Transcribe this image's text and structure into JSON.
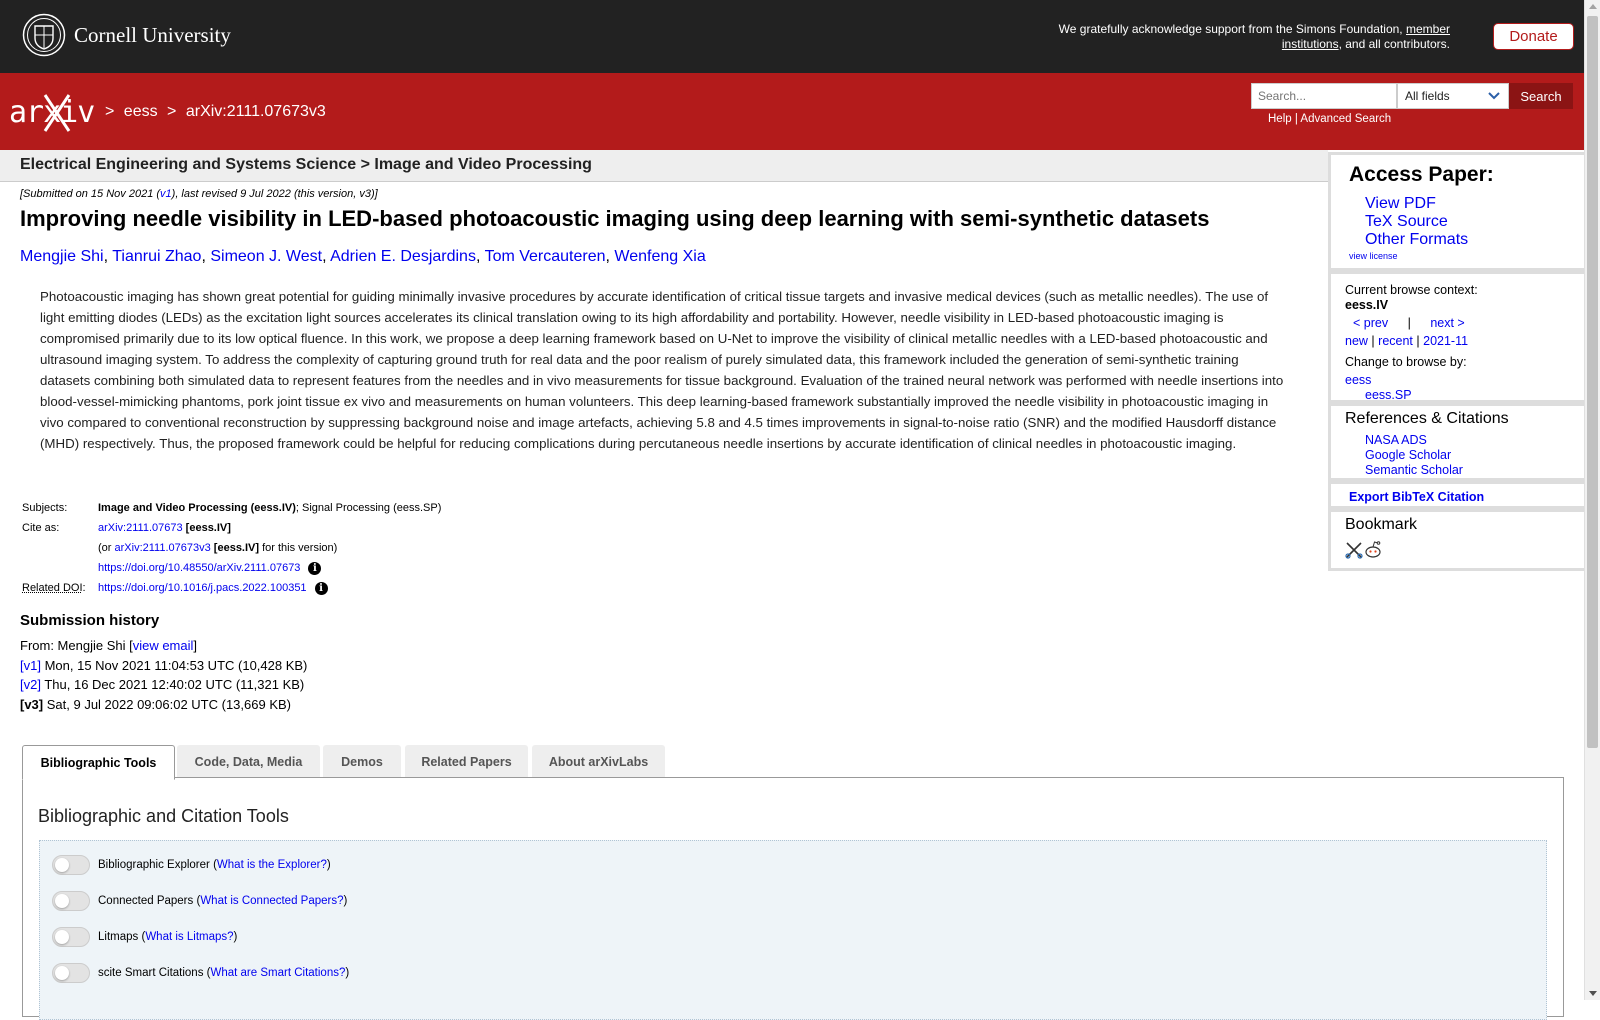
{
  "header": {
    "university": "Cornell University",
    "support_text": "We gratefully acknowledge support from the Simons Foundation,",
    "support_link": "member institutions",
    "support_tail": ", and all contributors.",
    "donate": "Donate"
  },
  "arxiv": {
    "crumb_sep": ">",
    "crumb_category": "eess",
    "crumb_id": "arXiv:2111.07673v3",
    "search_placeholder": "Search...",
    "search_field": "All fields",
    "search_button": "Search",
    "help": "Help",
    "link_sep": "|",
    "advanced": "Advanced Search"
  },
  "subheader": "Electrical Engineering and Systems Science > Image and Video Processing",
  "paper": {
    "submitted_prefix": "[Submitted on 15 Nov 2021 (",
    "submitted_v1": "v1",
    "submitted_suffix": "), last revised 9 Jul 2022 (this version, v3)]",
    "title": "Improving needle visibility in LED-based photoacoustic imaging using deep learning with semi-synthetic datasets",
    "authors": [
      "Mengjie Shi",
      "Tianrui Zhao",
      "Simeon J. West",
      "Adrien E. Desjardins",
      "Tom Vercauteren",
      "Wenfeng Xia"
    ],
    "abstract": "Photoacoustic imaging has shown great potential for guiding minimally invasive procedures by accurate identification of critical tissue targets and invasive medical devices (such as metallic needles). The use of light emitting diodes (LEDs) as the excitation light sources accelerates its clinical translation owing to its high affordability and portability. However, needle visibility in LED-based photoacoustic imaging is compromised primarily due to its low optical fluence. In this work, we propose a deep learning framework based on U-Net to improve the visibility of clinical metallic needles with a LED-based photoacoustic and ultrasound imaging system. To address the complexity of capturing ground truth for real data and the poor realism of purely simulated data, this framework included the generation of semi-synthetic training datasets combining both simulated data to represent features from the needles and in vivo measurements for tissue background. Evaluation of the trained neural network was performed with needle insertions into blood-vessel-mimicking phantoms, pork joint tissue ex vivo and measurements on human volunteers. This deep learning-based framework substantially improved the needle visibility in photoacoustic imaging in vivo compared to conventional reconstruction by suppressing background noise and image artefacts, achieving 5.8 and 4.5 times improvements in signal-to-noise ratio (SNR) and the modified Hausdorff distance (MHD) respectively. Thus, the proposed framework could be helpful for reducing complications during percutaneous needle insertions by accurate identification of clinical needles in photoacoustic imaging."
  },
  "meta": {
    "subjects_label": "Subjects:",
    "subjects_primary": "Image and Video Processing (eess.IV)",
    "subjects_rest": "; Signal Processing (eess.SP)",
    "cite_label": "Cite as:",
    "cite_id": "arXiv:2111.07673",
    "cite_tag": "[eess.IV]",
    "cite_or_prefix": "(or",
    "cite_version_id": "arXiv:2111.07673v3",
    "cite_version_tag": "[eess.IV]",
    "cite_version_suffix": "for this version)",
    "doi": "https://doi.org/10.48550/arXiv.2111.07673",
    "related_label": "Related DOI",
    "related_colon": ":",
    "related_doi": "https://doi.org/10.1016/j.pacs.2022.100351",
    "info_glyph": "i"
  },
  "history": {
    "title": "Submission history",
    "from_prefix": "From: Mengjie Shi [",
    "from_link": "view email",
    "from_suffix": "]",
    "versions": [
      {
        "label": "[v1]",
        "text": " Mon, 15 Nov 2021 11:04:53 UTC (10,428 KB)"
      },
      {
        "label": "[v2]",
        "text": " Thu, 16 Dec 2021 12:40:02 UTC (11,321 KB)"
      },
      {
        "label": "[v3]",
        "text": " Sat, 9 Jul 2022 09:06:02 UTC (13,669 KB)"
      }
    ]
  },
  "tabs": [
    "Bibliographic Tools",
    "Code, Data, Media",
    "Demos",
    "Related Papers",
    "About arXivLabs"
  ],
  "tools": {
    "title": "Bibliographic and Citation Tools",
    "paren_open": "(",
    "paren_close": ")",
    "items": [
      {
        "name": "Bibliographic Explorer",
        "link": "What is the Explorer?"
      },
      {
        "name": "Connected Papers",
        "link": "What is Connected Papers?"
      },
      {
        "name": "Litmaps",
        "link": "What is Litmaps?"
      },
      {
        "name": "scite Smart Citations",
        "link": "What are Smart Citations?"
      }
    ]
  },
  "sidebar": {
    "access_title": "Access Paper:",
    "access_links": [
      "View PDF",
      "TeX Source",
      "Other Formats"
    ],
    "view_license": "view license",
    "context_label": "Current browse context:",
    "context_value": "eess.IV",
    "prev": "< prev",
    "nav_sep": "|",
    "next": "next >",
    "new": "new",
    "recent": "recent",
    "month": "2021-11",
    "change_label": "Change to browse by:",
    "browse_parent": "eess",
    "browse_child": "eess.SP",
    "refs_title": "References & Citations",
    "refs_links": [
      "NASA ADS",
      "Google Scholar",
      "Semantic Scholar"
    ],
    "bibtex": "Export BibTeX Citation",
    "bookmark_title": "Bookmark"
  },
  "colors": {
    "arxiv_red": "#b31b1b",
    "cornell_black": "#222222",
    "link_blue": "#0000ee"
  }
}
